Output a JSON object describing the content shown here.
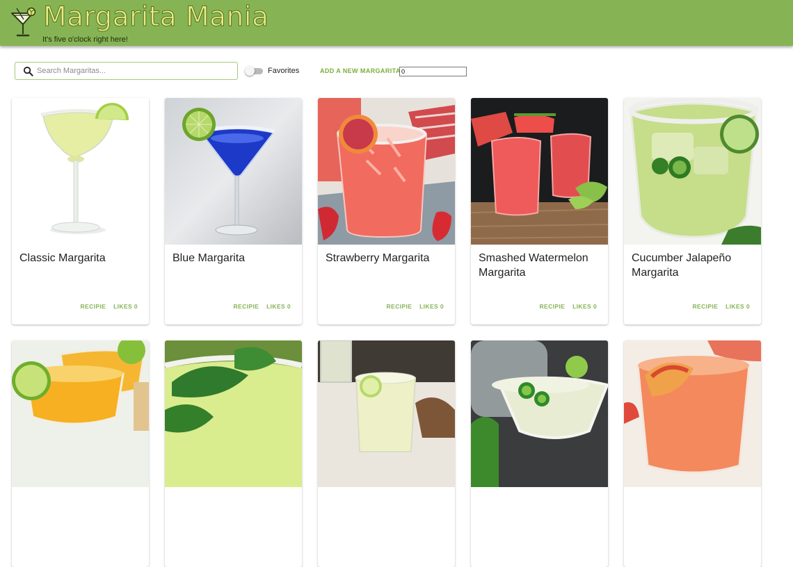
{
  "header": {
    "title": "Margarita Mania",
    "tagline": "It's five o'clock right here!",
    "logo_icon": "margarita-glass-icon"
  },
  "toolbar": {
    "search_placeholder": "Search Margaritas...",
    "search_value": "",
    "search_icon": "search-icon",
    "favorites_label": "Favorites",
    "favorites_on": false,
    "add_label": "ADD A NEW MARGARITA",
    "add_value": "0"
  },
  "colors": {
    "header_bg": "#86b455",
    "title_fill": "#e6ef84",
    "accent": "#86b455"
  },
  "cards": [
    {
      "title": "Classic Margarita",
      "recipe_label": "RECIPIE",
      "likes_label": "LIKES 0"
    },
    {
      "title": "Blue Margarita",
      "recipe_label": "RECIPIE",
      "likes_label": "LIKES 0"
    },
    {
      "title": "Strawberry Margarita",
      "recipe_label": "RECIPIE",
      "likes_label": "LIKES 0"
    },
    {
      "title": "Smashed Watermelon Margarita",
      "recipe_label": "RECIPIE",
      "likes_label": "LIKES 0"
    },
    {
      "title": "Cucumber Jalapeño Margarita",
      "recipe_label": "RECIPIE",
      "likes_label": "LIKES 0"
    },
    {
      "title": "",
      "recipe_label": "",
      "likes_label": ""
    },
    {
      "title": "",
      "recipe_label": "",
      "likes_label": ""
    },
    {
      "title": "",
      "recipe_label": "",
      "likes_label": ""
    },
    {
      "title": "",
      "recipe_label": "",
      "likes_label": ""
    },
    {
      "title": "",
      "recipe_label": "",
      "likes_label": ""
    }
  ]
}
